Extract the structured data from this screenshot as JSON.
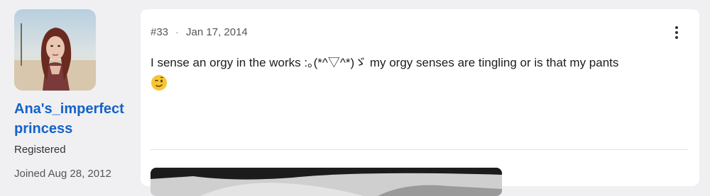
{
  "author": {
    "avatar_icon": "user-avatar-photo",
    "username": "Ana's_imperfect princess",
    "role": "Registered",
    "joined": "Joined Aug 28, 2012"
  },
  "post": {
    "number": "#33",
    "separator": "·",
    "date": "Jan 17, 2014",
    "menu_icon": "kebab-menu-icon",
    "body": "I sense an orgy in the works :｡(*^▽^*)ゞ my orgy senses are tingling or is that my pants",
    "emoji_icon": "winking-face-emoji-icon",
    "embedded_image_icon": "embedded-image"
  },
  "colors": {
    "page_bg": "#f0f0f2",
    "card_bg": "#ffffff",
    "username": "#1462c8"
  }
}
